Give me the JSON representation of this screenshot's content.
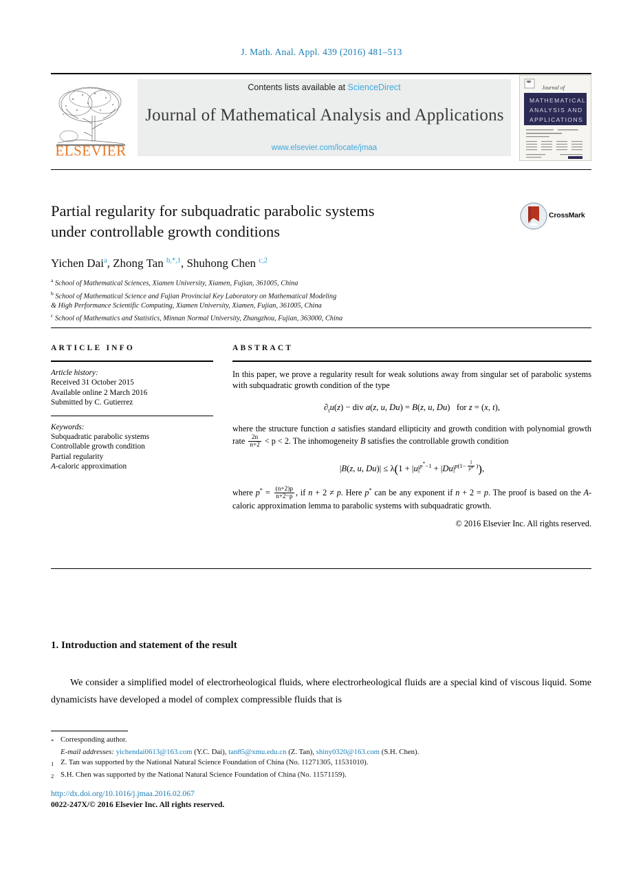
{
  "running_head": "J. Math. Anal. Appl. 439 (2016) 481–513",
  "masthead": {
    "contents_prefix": "Contents lists available at ",
    "sciencedirect": "ScienceDirect",
    "journal_title": "Journal of Mathematical Analysis and Applications",
    "journal_url": "www.elsevier.com/locate/jmaa",
    "publisher": "ELSEVIER",
    "cover_title_lines": [
      "Journal of",
      "MATHEMATICAL",
      "ANALYSIS AND",
      "APPLICATIONS"
    ]
  },
  "article": {
    "title_line1": "Partial regularity for subquadratic parabolic systems",
    "title_line2": "under controllable growth conditions",
    "crossmark_label": "CrossMark",
    "authors": [
      {
        "name": "Yichen Dai",
        "marks": "a"
      },
      {
        "name": "Zhong Tan",
        "marks": "b,*,1"
      },
      {
        "name": "Shuhong Chen",
        "marks": "c,2"
      }
    ],
    "affiliations": [
      {
        "mark": "a",
        "text": "School of Mathematical Sciences, Xiamen University, Xiamen, Fujian, 361005, China"
      },
      {
        "mark": "b",
        "text": "School of Mathematical Science and Fujian Provincial Key Laboratory on Mathematical Modeling"
      },
      {
        "mark": "",
        "text": "& High Performance Scientific Computing, Xiamen University, Xiamen, Fujian, 361005, China"
      },
      {
        "mark": "c",
        "text": "School of Mathematics and Statistics, Minnan Normal University, Zhangzhou, Fujian, 363000, China"
      }
    ]
  },
  "article_info": {
    "heading": "ARTICLE INFO",
    "history_label": "Article history:",
    "history": [
      "Received 31 October 2015",
      "Available online 2 March 2016",
      "Submitted by C. Gutierrez"
    ],
    "keywords_label": "Keywords:",
    "keywords": [
      "Subquadratic parabolic systems",
      "Controllable growth condition",
      "Partial regularity",
      "A-caloric approximation"
    ]
  },
  "abstract": {
    "heading": "ABSTRACT",
    "para1": "In this paper, we prove a regularity result for weak solutions away from singular set of parabolic systems with subquadratic growth condition of the type",
    "equation1": "∂tu(z) − div a(z, u, Du) = B(z, u, Du)   for z = (x, t),",
    "para2_a": "where the structure function ",
    "para2_var1": "a",
    "para2_b": " satisfies standard ellipticity and growth condition with polynomial growth rate ",
    "para2_frac_num": "2n",
    "para2_frac_den": "n+2",
    "para2_c": " < p < 2. The inhomogeneity ",
    "para2_var2": "B",
    "para2_d": " satisfies the controllable growth condition",
    "equation2": "|B(z, u, Du)| ≤ λ(1 + |u|^{p*−1} + |Du|^{p(1−1/p*)}),",
    "para3_a": "where p",
    "para3_star": "*",
    "para3_eq": " = ",
    "para3_frac_num": "(n+2)p",
    "para3_frac_den": "n+2−p",
    "para3_b": ", if n + 2 ≠ p. Here p",
    "para3_c": " can be any exponent if n + 2 = p. The proof is based on the ",
    "para3_cal": "A",
    "para3_d": "-caloric approximation lemma to parabolic systems with subquadratic growth.",
    "copyright": "© 2016 Elsevier Inc. All rights reserved."
  },
  "body": {
    "section_heading": "1. Introduction and statement of the result",
    "paragraph": "We consider a simplified model of electrorheological fluids, where electrorheological fluids are a special kind of viscous liquid. Some dynamicists have developed a model of complex compressible fluids that is"
  },
  "footnotes": {
    "corresponding": {
      "mark": "*",
      "text": "Corresponding author."
    },
    "emails": {
      "label": "E-mail addresses:",
      "items": [
        {
          "address": "yichendai0613@163.com",
          "owner": "(Y.C. Dai)"
        },
        {
          "address": "tan85@xmu.edu.cn",
          "owner": "(Z. Tan)"
        },
        {
          "address": "shiny0320@163.com",
          "owner": "(S.H. Chen)"
        }
      ]
    },
    "notes": [
      {
        "mark": "1",
        "text": "Z. Tan was supported by the National Natural Science Foundation of China (No. 11271305, 11531010)."
      },
      {
        "mark": "2",
        "text": "S.H. Chen was supported by the National Natural Science Foundation of China (No. 11571159)."
      }
    ]
  },
  "footer": {
    "doi": "http://dx.doi.org/10.1016/j.jmaa.2016.02.067",
    "issn_line": "0022-247X/© 2016 Elsevier Inc. All rights reserved."
  },
  "colors": {
    "link_blue": "#1a7db6",
    "sciencedirect_blue": "#3ba9dd",
    "elsevier_orange": "#e87722",
    "cover_navy": "#2b2a54",
    "crossmark_red": "#b5341f"
  }
}
